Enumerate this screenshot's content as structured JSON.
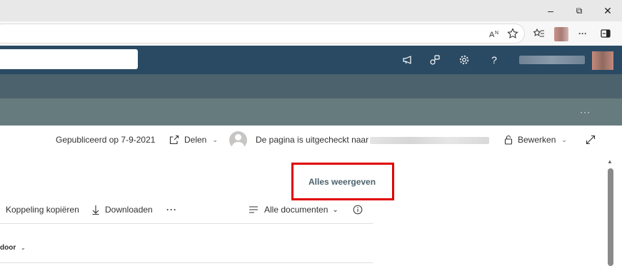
{
  "browser": {
    "window_controls": {
      "minimize": "–",
      "restore": "⧉",
      "close": "✕"
    },
    "toolbar": {
      "read_aloud": "A̅",
      "more": "···"
    }
  },
  "suitebar": {
    "icons": [
      "megaphone-icon",
      "share-network-icon",
      "gear-icon",
      "help-icon"
    ],
    "help_label": "?"
  },
  "site": {
    "more": "···"
  },
  "page_commands": {
    "published": "Gepubliceerd op 7-9-2021",
    "share": "Delen",
    "checkout": "De pagina is uitgecheckt naar",
    "edit": "Bewerken"
  },
  "library": {
    "view_all": "Alles weergeven",
    "copy_link": "Koppeling kopiëren",
    "download": "Downloaden",
    "more": "···",
    "view": "Alle documenten",
    "column_header": "door"
  },
  "colors": {
    "suitebar": "#2a4a63",
    "nav": "#4c626c",
    "header": "#667b7e",
    "highlight": "#e00000"
  }
}
